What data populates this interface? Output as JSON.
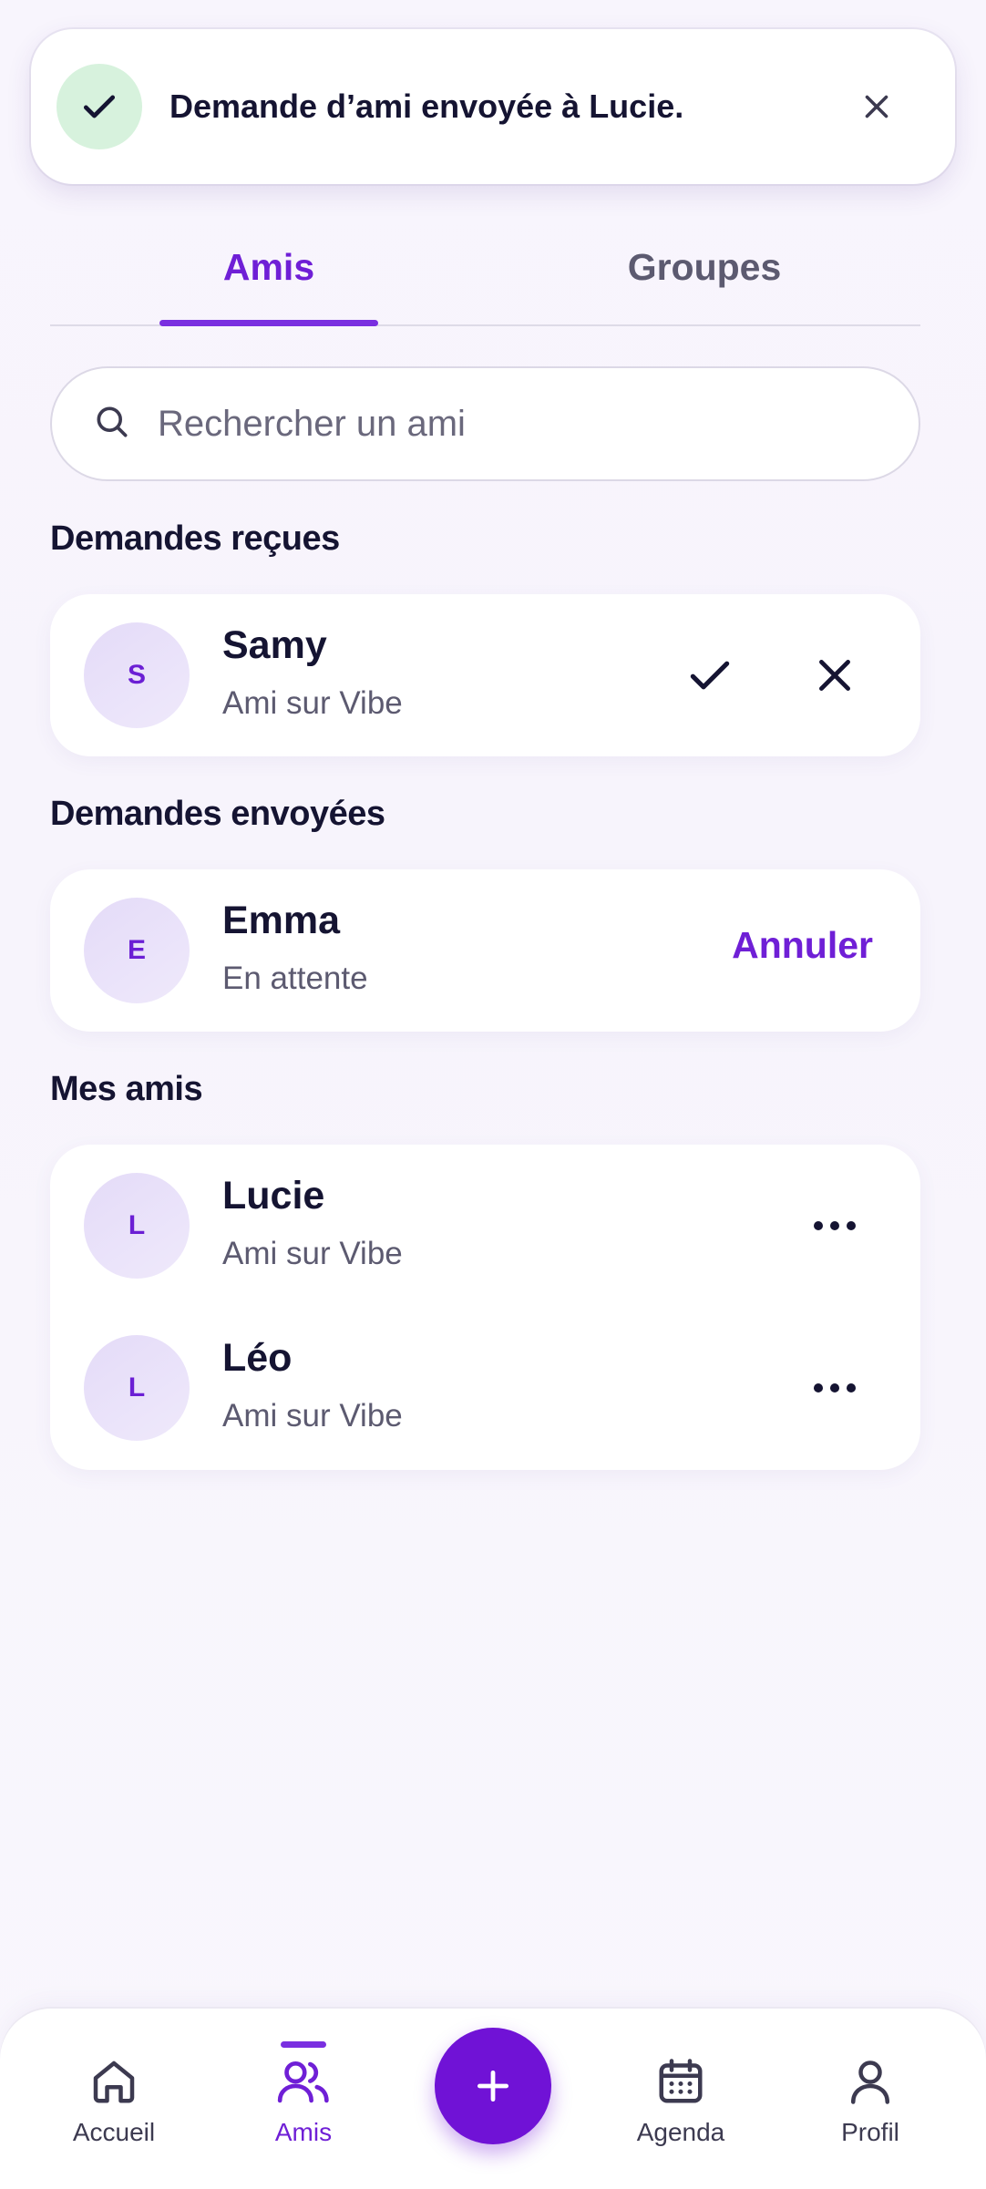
{
  "toast": {
    "message": "Demande d’ami envoyée à Lucie."
  },
  "tabs": [
    {
      "label": "Amis",
      "active": true
    },
    {
      "label": "Groupes",
      "active": false
    }
  ],
  "search": {
    "placeholder": "Rechercher un ami"
  },
  "received": {
    "title": "Demandes reçues",
    "items": [
      {
        "initial": "S",
        "name": "Samy",
        "subtitle": "Ami sur Vibe"
      }
    ]
  },
  "sent": {
    "title": "Demandes envoyées",
    "items": [
      {
        "initial": "E",
        "name": "Emma",
        "subtitle": "En attente",
        "action": "Annuler"
      }
    ]
  },
  "friends": {
    "title": "Mes amis",
    "items": [
      {
        "initial": "L",
        "name": "Lucie",
        "subtitle": "Ami sur Vibe"
      },
      {
        "initial": "L",
        "name": "Léo",
        "subtitle": "Ami sur Vibe"
      }
    ]
  },
  "nav": {
    "items": [
      {
        "label": "Accueil",
        "icon": "home-icon"
      },
      {
        "label": "Amis",
        "icon": "friends-icon",
        "active": true
      },
      {
        "label": "Agenda",
        "icon": "calendar-icon"
      },
      {
        "label": "Profil",
        "icon": "profile-icon"
      }
    ],
    "fab_icon": "plus-icon"
  },
  "colors": {
    "accent": "#6f1fd6",
    "success_bg": "#d7f2dd",
    "text": "#151432",
    "muted": "#5c5a70"
  }
}
